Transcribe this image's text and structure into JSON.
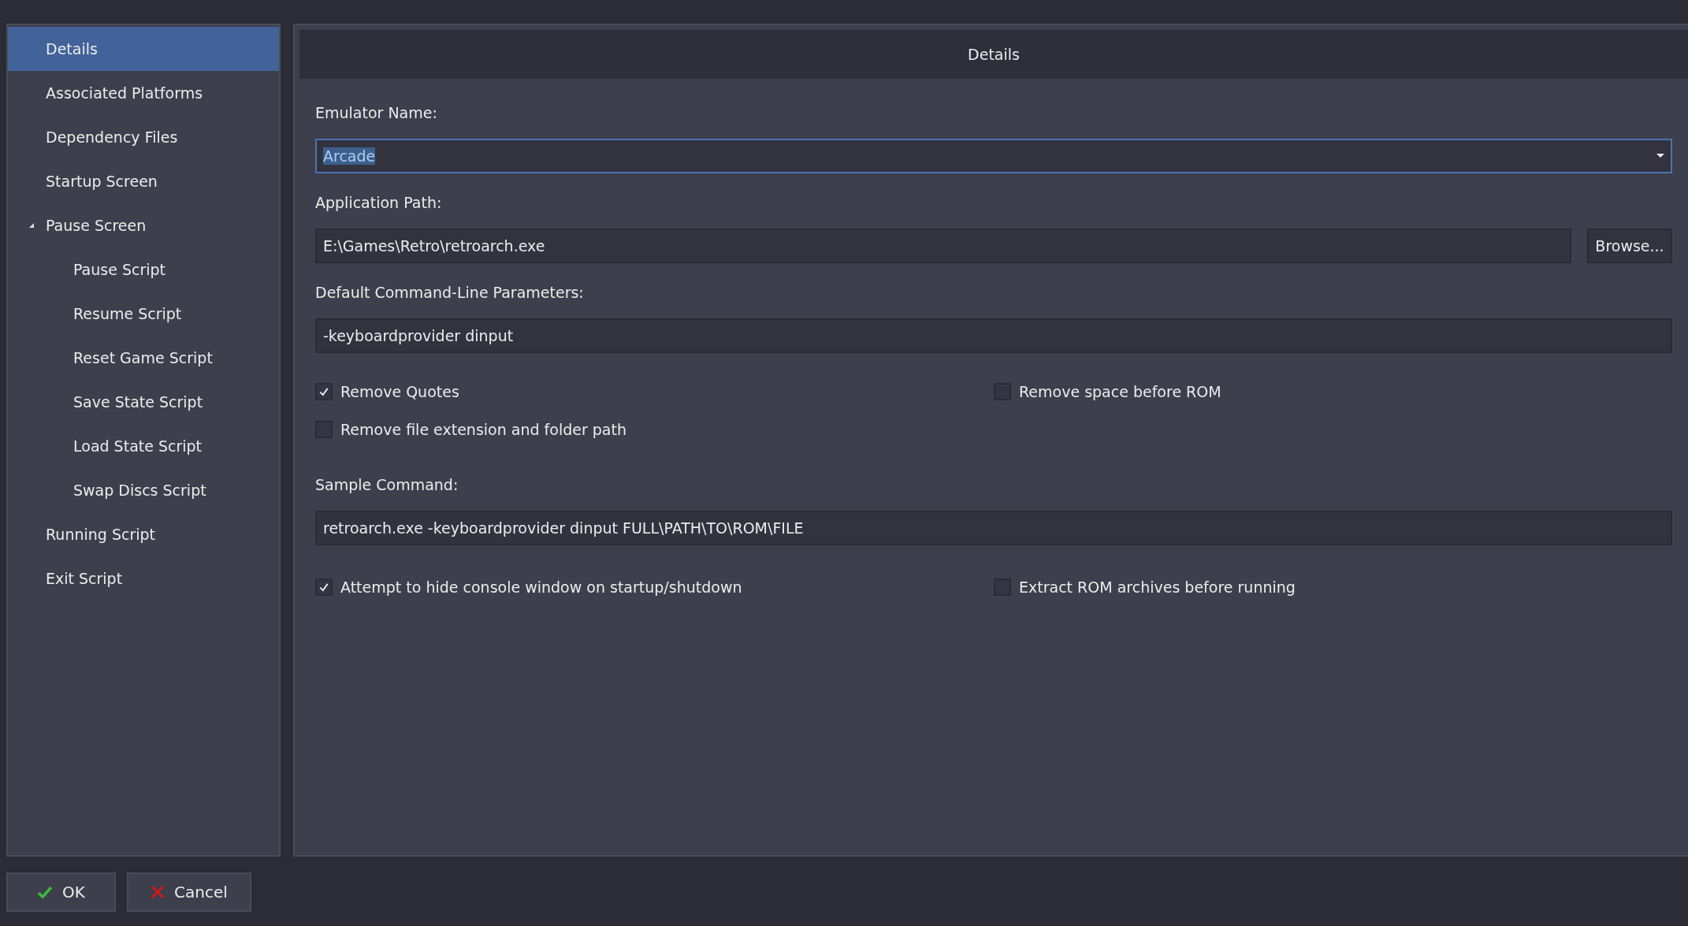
{
  "sidebar": {
    "items": [
      {
        "label": "Details",
        "selected": true
      },
      {
        "label": "Associated Platforms",
        "selected": false
      },
      {
        "label": "Dependency Files",
        "selected": false
      },
      {
        "label": "Startup Screen",
        "selected": false
      },
      {
        "label": "Pause Screen",
        "selected": false,
        "expanded": true,
        "children": [
          {
            "label": "Pause Script",
            "selected": false
          },
          {
            "label": "Resume Script",
            "selected": false
          },
          {
            "label": "Reset Game Script",
            "selected": false
          },
          {
            "label": "Save State Script",
            "selected": false
          },
          {
            "label": "Load State Script",
            "selected": false
          },
          {
            "label": "Swap Discs Script",
            "selected": false
          }
        ]
      },
      {
        "label": "Running Script",
        "selected": false
      },
      {
        "label": "Exit Script",
        "selected": false
      }
    ]
  },
  "panel": {
    "title": "Details",
    "emulator_name": {
      "label": "Emulator Name:",
      "value": "Arcade",
      "text_selected": true,
      "focused": true
    },
    "application_path": {
      "label": "Application Path:",
      "value": "E:\\Games\\Retro\\retroarch.exe",
      "button": "Browse..."
    },
    "parameters": {
      "label": "Default Command-Line Parameters:",
      "value": "-keyboardprovider dinput"
    },
    "options": [
      {
        "label": "Remove Quotes",
        "checked": true
      },
      {
        "label": "Remove space before ROM",
        "checked": false
      },
      {
        "label": "Remove file extension and folder path",
        "checked": false
      }
    ],
    "sample_command": {
      "label": "Sample Command:",
      "value": "retroarch.exe -keyboardprovider dinput FULL\\PATH\\TO\\ROM\\FILE"
    },
    "options_2": [
      {
        "label": "Attempt to hide console window on startup/shutdown",
        "checked": true
      },
      {
        "label": "Extract ROM archives before running",
        "checked": false
      }
    ]
  },
  "buttons": [
    {
      "label": "OK",
      "kind": "ok"
    },
    {
      "label": "Cancel",
      "kind": "cancel"
    }
  ]
}
